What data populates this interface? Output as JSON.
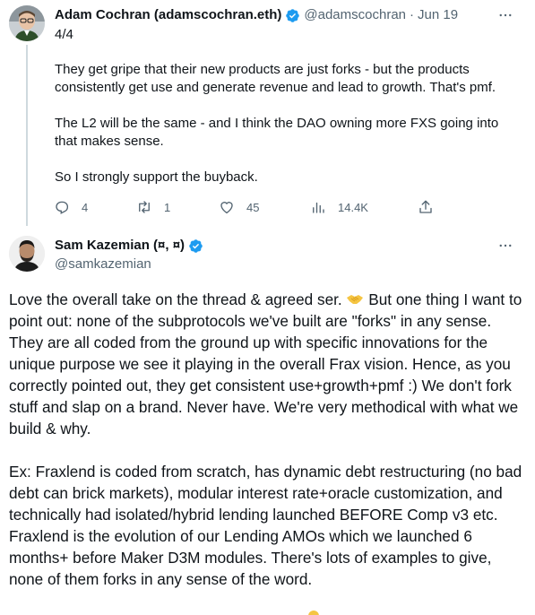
{
  "tweet1": {
    "author_name": "Adam Cochran (adamscochran.eth)",
    "handle": "@adamscochran",
    "separator": "·",
    "date": "Jun 19",
    "paragraphs": [
      "4/4",
      "They get gripe that their new products are just forks - but the products consistently get use and generate revenue and lead to growth. That's pmf.",
      "The L2 will be the same - and I think the DAO owning more FXS going into that makes sense.",
      "So I strongly support the buyback."
    ],
    "actions": {
      "replies": "4",
      "retweets": "1",
      "likes": "45",
      "views": "14.4K"
    }
  },
  "tweet2": {
    "author_name": "Sam Kazemian (¤, ¤)",
    "handle": "@samkazemian",
    "para1_before_emoji": "Love the overall take on the thread & agreed ser.",
    "para1_after_emoji": " But one thing I want to point out: none of the subprotocols we've built are \"forks\" in any sense. They are all coded from the ground up with specific innovations for the unique purpose we see it playing in the overall Frax vision. Hence, as you correctly pointed out, they get consistent use+growth+pmf :) We don't fork stuff and slap on a brand. Never have. We're very methodical with what we build & why.",
    "para2": "Ex: Fraxlend is coded from scratch, has dynamic debt restructuring (no bad debt can brick markets), modular interest rate+oracle customization, and technically had isolated/hybrid lending launched BEFORE Comp v3 etc. Fraxlend is the evolution of our Lending AMOs which we launched 6 months+ before Maker D3M modules. There's lots of examples to give, none of them forks in any sense of the word."
  },
  "icons": {
    "verified": "verified-badge-icon",
    "more": "more-icon",
    "reply": "reply-icon",
    "retweet": "retweet-icon",
    "like": "heart-icon",
    "views": "views-icon",
    "share": "share-icon",
    "handshake": "handshake-emoji-icon"
  },
  "colors": {
    "verified_blue": "#1d9bf0",
    "text": "#0f1419",
    "muted": "#536471",
    "thread_line": "#cfd9de"
  }
}
